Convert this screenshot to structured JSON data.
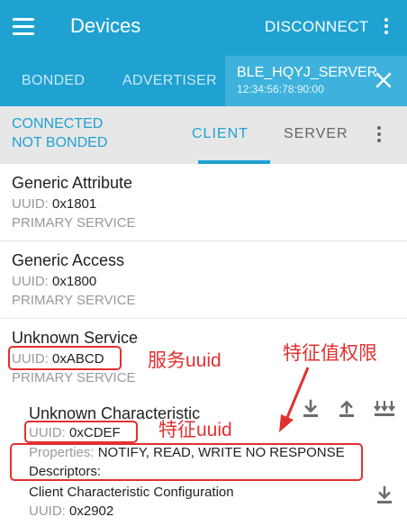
{
  "app_bar": {
    "title": "Devices",
    "action_label": "DISCONNECT",
    "icons": [
      "menu-icon",
      "more-vert-icon"
    ]
  },
  "tabs": {
    "bonded": "BONDED",
    "advertiser": "ADVERTISER",
    "device_name": "BLE_HQYJ_SERVER",
    "device_address": "12:34:56:78:90:00"
  },
  "connection": {
    "status": "CONNECTED",
    "bond_state": "NOT BONDED",
    "tab_client": "CLIENT",
    "tab_server": "SERVER"
  },
  "services": [
    {
      "name": "Generic Attribute",
      "uuid_label": "UUID:",
      "uuid": "0x1801",
      "type": "PRIMARY SERVICE"
    },
    {
      "name": "Generic Access",
      "uuid_label": "UUID:",
      "uuid": "0x1800",
      "type": "PRIMARY SERVICE"
    },
    {
      "name": "Unknown Service",
      "uuid_label": "UUID:",
      "uuid": "0xABCD",
      "type": "PRIMARY SERVICE"
    }
  ],
  "characteristic": {
    "name": "Unknown Characteristic",
    "uuid_label": "UUID:",
    "uuid": "0xCDEF",
    "properties_label": "Properties:",
    "properties": "NOTIFY, READ, WRITE NO RESPONSE",
    "descriptors_label": "Descriptors:",
    "descriptor_name": "Client Characteristic Configuration",
    "descriptor_uuid_label": "UUID:",
    "descriptor_uuid": "0x2902"
  },
  "annotations": {
    "service_uuid": "服务uuid",
    "char_uuid": "特征uuid",
    "permissions": "特征值权限"
  },
  "colors": {
    "primary": "#1fa2d2",
    "annotation_red": "#e23030",
    "icon_gray": "#6b6b6b"
  }
}
